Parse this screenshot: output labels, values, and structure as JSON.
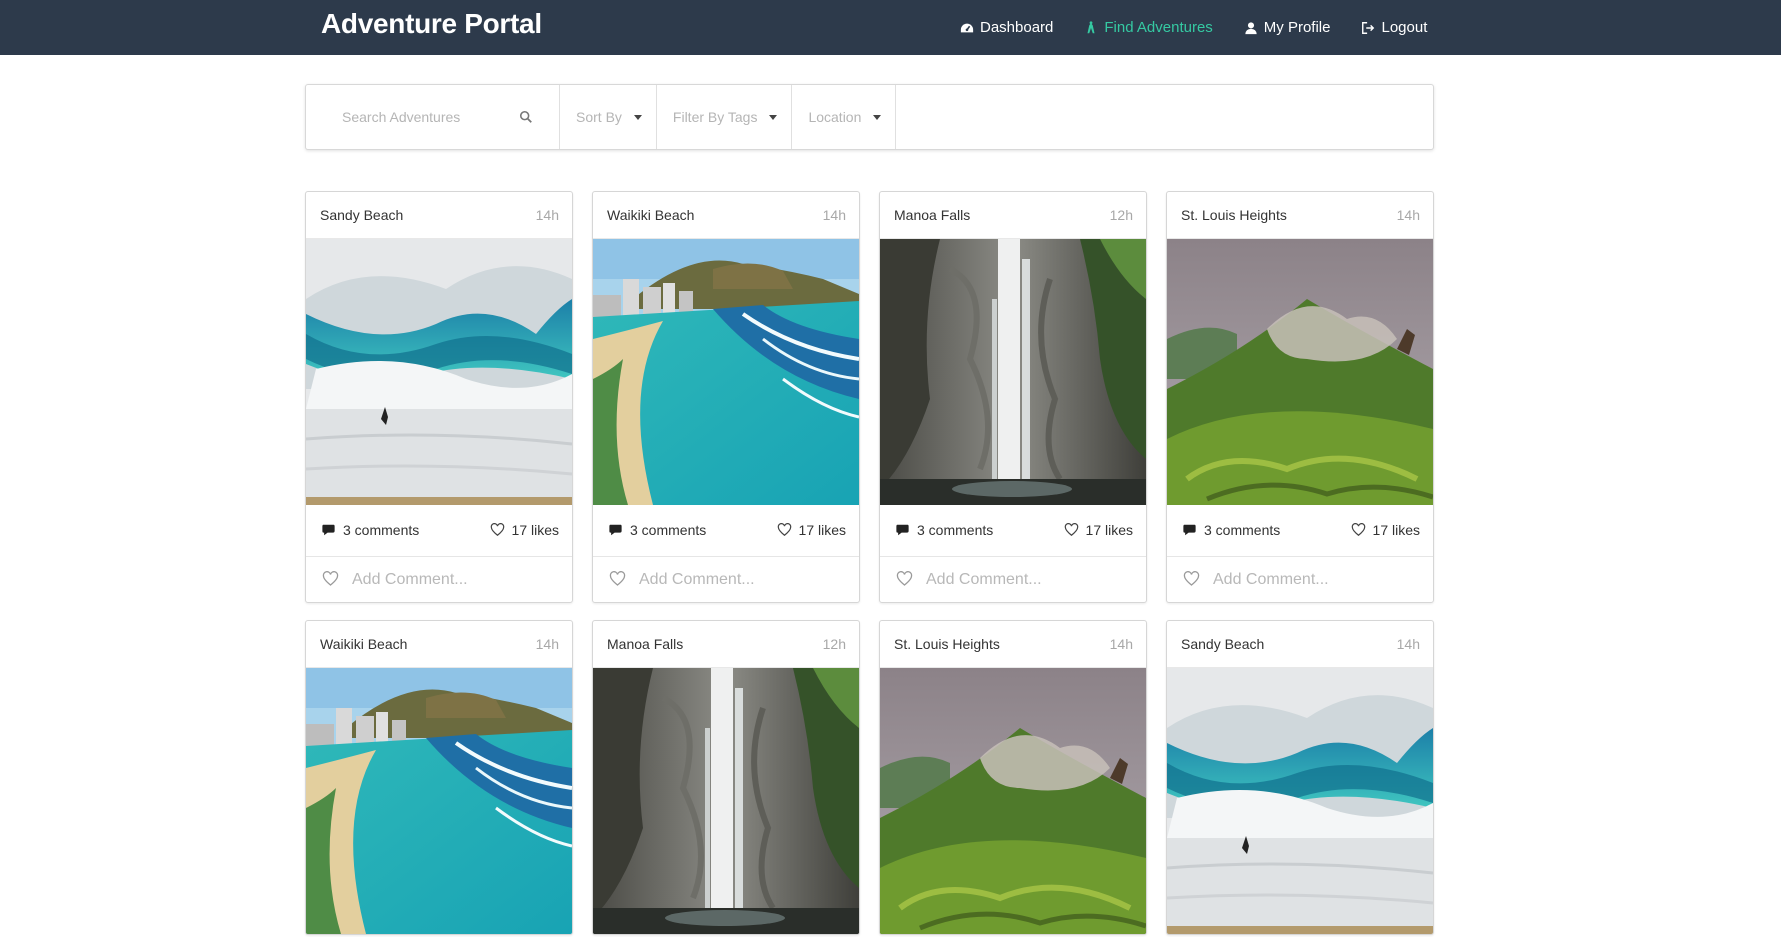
{
  "navbar": {
    "brand": "Adventure Portal",
    "items": [
      {
        "label": "Dashboard",
        "icon": "dashboard-icon",
        "active": false
      },
      {
        "label": "Find Adventures",
        "icon": "hiker-icon",
        "active": true
      },
      {
        "label": "My Profile",
        "icon": "user-icon",
        "active": false
      },
      {
        "label": "Logout",
        "icon": "logout-icon",
        "active": false
      }
    ]
  },
  "filters": {
    "search_placeholder": "Search Adventures",
    "sort_label": "Sort By",
    "tags_label": "Filter By Tags",
    "location_label": "Location"
  },
  "cards": [
    {
      "title": "Sandy Beach",
      "time": "14h",
      "image": "wave",
      "comments": "3 comments",
      "likes": "17 likes",
      "comment_placeholder": "Add Comment..."
    },
    {
      "title": "Waikiki Beach",
      "time": "14h",
      "image": "beach",
      "comments": "3 comments",
      "likes": "17 likes",
      "comment_placeholder": "Add Comment..."
    },
    {
      "title": "Manoa Falls",
      "time": "12h",
      "image": "falls",
      "comments": "3 comments",
      "likes": "17 likes",
      "comment_placeholder": "Add Comment..."
    },
    {
      "title": "St. Louis Heights",
      "time": "14h",
      "image": "ridge",
      "comments": "3 comments",
      "likes": "17 likes",
      "comment_placeholder": "Add Comment..."
    },
    {
      "title": "Waikiki Beach",
      "time": "14h",
      "image": "beach"
    },
    {
      "title": "Manoa Falls",
      "time": "12h",
      "image": "falls"
    },
    {
      "title": "St. Louis Heights",
      "time": "14h",
      "image": "ridge"
    },
    {
      "title": "Sandy Beach",
      "time": "14h",
      "image": "wave"
    }
  ],
  "colors": {
    "navbar_bg": "#2d3a4b",
    "accent": "#35c9a2"
  }
}
